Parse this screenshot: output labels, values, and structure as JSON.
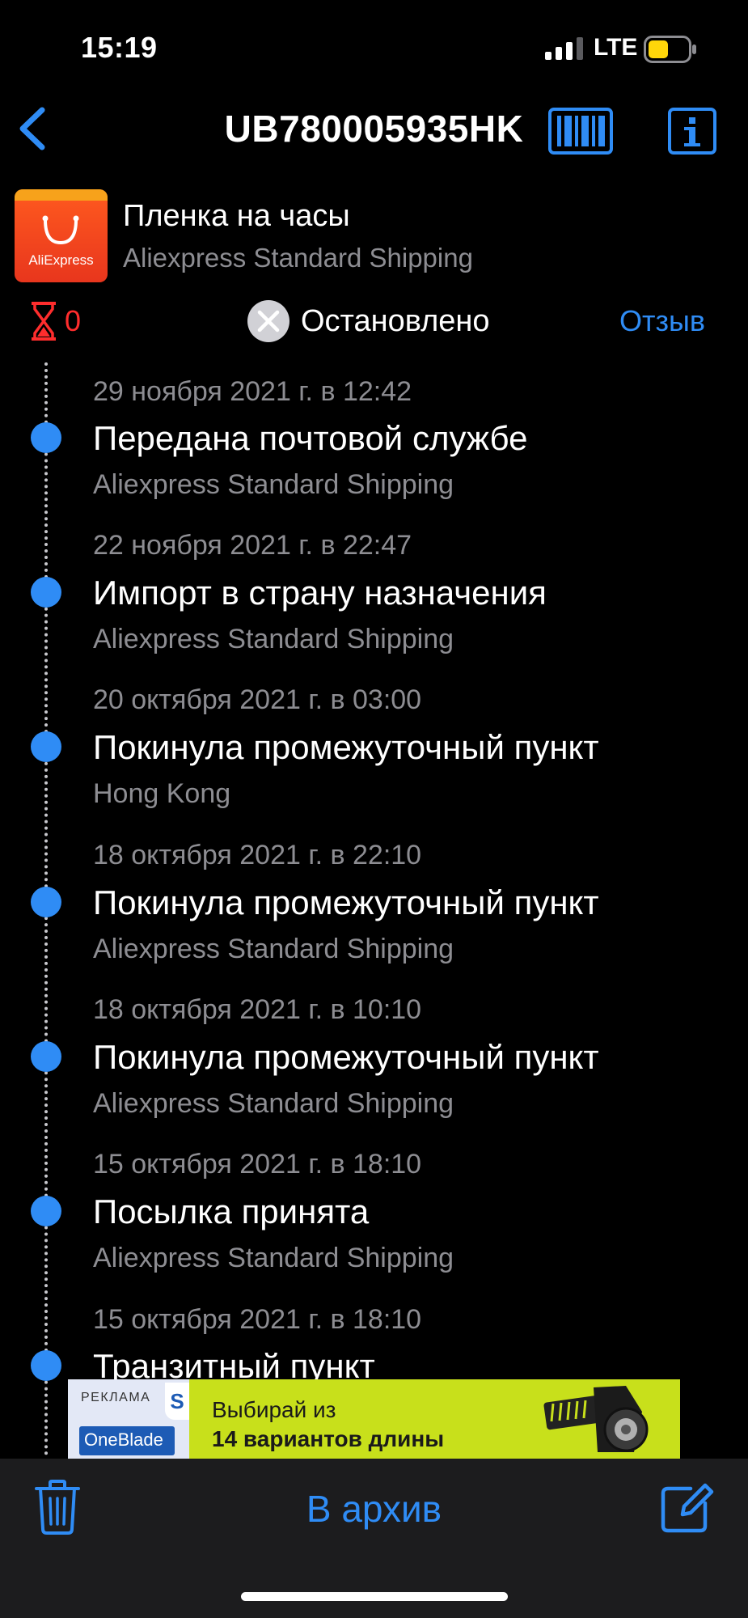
{
  "status_bar": {
    "time": "15:19",
    "network": "LTE",
    "icons": [
      "signal-icon",
      "battery-icon"
    ]
  },
  "nav": {
    "title": "UB780005935HK",
    "icons": [
      "back-chevron-icon",
      "barcode-icon",
      "info-icon"
    ]
  },
  "header": {
    "store_logo_text": "AliExpress",
    "item_name": "Пленка на часы",
    "service": "Aliexpress Standard Shipping"
  },
  "status_row": {
    "days_count": "0",
    "status": "Остановлено",
    "review": "Отзыв",
    "icons": [
      "hourglass-icon",
      "stopped-icon"
    ]
  },
  "events": [
    {
      "date": "29 ноября 2021 г. в 12:42",
      "title": "Передана почтовой службе",
      "location": "Aliexpress Standard Shipping"
    },
    {
      "date": "22 ноября 2021 г. в 22:47",
      "title": "Импорт в страну назначения",
      "location": "Aliexpress Standard Shipping"
    },
    {
      "date": "20 октября 2021 г. в 03:00",
      "title": "Покинула промежуточный пункт",
      "location": "Hong Kong"
    },
    {
      "date": "18 октября 2021 г. в 22:10",
      "title": "Покинула промежуточный пункт",
      "location": "Aliexpress Standard Shipping"
    },
    {
      "date": "18 октября 2021 г. в 10:10",
      "title": "Покинула промежуточный пункт",
      "location": "Aliexpress Standard Shipping"
    },
    {
      "date": "15 октября 2021 г. в 18:10",
      "title": "Посылка принята",
      "location": "Aliexpress Standard Shipping"
    },
    {
      "date": "15 октября 2021 г. в 18:10",
      "title": "Транзитный пункт",
      "location": ""
    }
  ],
  "ad": {
    "label": "РЕКЛАМА",
    "brand": "OneBlade",
    "brand_mark": "S",
    "line1": "Выбирай из",
    "line2": "14 вариантов длины"
  },
  "toolbar": {
    "archive_label": "В архив",
    "icons": [
      "trash-icon",
      "compose-icon"
    ]
  },
  "colors": {
    "accent": "#2f8cf5",
    "background": "#000000",
    "secondary_text": "#8d8d92",
    "alert": "#ff2d2d",
    "ad_background": "#c8e01b"
  }
}
